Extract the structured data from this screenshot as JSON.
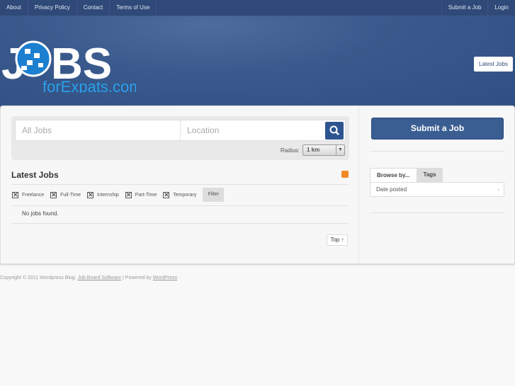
{
  "topnav": {
    "left": [
      "About",
      "Privacy Policy",
      "Contact",
      "Terms of Use"
    ],
    "right": [
      "Submit a Job",
      "Login"
    ]
  },
  "header": {
    "logo_text": "JOBS forExpats.com",
    "latest_jobs": "Latest Jobs"
  },
  "search": {
    "jobs_placeholder": "All Jobs",
    "location_placeholder": "Location",
    "radius_label": "Radius:",
    "radius_value": "1 km"
  },
  "main": {
    "title": "Latest Jobs",
    "filters": [
      "Freelance",
      "Full-Time",
      "Internship",
      "Part-Time",
      "Temporary"
    ],
    "filter_button": "Filter",
    "empty": "No jobs found.",
    "top": "Top ↑"
  },
  "sidebar": {
    "submit": "Submit a Job",
    "tabs": [
      "Browse by...",
      "Tags"
    ],
    "item": "Date posted"
  },
  "footer": {
    "copyright": "Copyright © 2011 Wordpress Blog.",
    "link1": "Job Board Software",
    "sep": " | Powered by ",
    "link2": "WordPress"
  },
  "colors": {
    "brand": "#2f4a78",
    "accent": "#2e5590",
    "rss": "#f08a24"
  }
}
